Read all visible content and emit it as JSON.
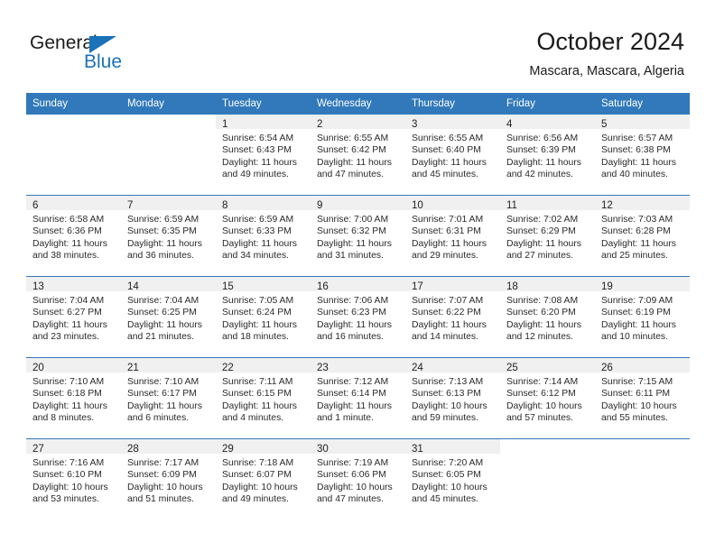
{
  "brand": {
    "name_top": "General",
    "name_bottom": "Blue",
    "triangle_icon": "triangle-icon",
    "accent_color": "#1a72b8"
  },
  "header": {
    "title": "October 2024",
    "subtitle": "Mascara, Mascara, Algeria"
  },
  "theme": {
    "header_blue": "#3179ba",
    "daynum_band": "#f0f0f0",
    "text": "#222222"
  },
  "weekday_headers": [
    "Sunday",
    "Monday",
    "Tuesday",
    "Wednesday",
    "Thursday",
    "Friday",
    "Saturday"
  ],
  "weeks": [
    [
      {
        "day": "",
        "sunrise": "",
        "sunset": "",
        "daylight": "",
        "empty": true
      },
      {
        "day": "",
        "sunrise": "",
        "sunset": "",
        "daylight": "",
        "empty": true
      },
      {
        "day": "1",
        "sunrise": "Sunrise: 6:54 AM",
        "sunset": "Sunset: 6:43 PM",
        "daylight": "Daylight: 11 hours and 49 minutes."
      },
      {
        "day": "2",
        "sunrise": "Sunrise: 6:55 AM",
        "sunset": "Sunset: 6:42 PM",
        "daylight": "Daylight: 11 hours and 47 minutes."
      },
      {
        "day": "3",
        "sunrise": "Sunrise: 6:55 AM",
        "sunset": "Sunset: 6:40 PM",
        "daylight": "Daylight: 11 hours and 45 minutes."
      },
      {
        "day": "4",
        "sunrise": "Sunrise: 6:56 AM",
        "sunset": "Sunset: 6:39 PM",
        "daylight": "Daylight: 11 hours and 42 minutes."
      },
      {
        "day": "5",
        "sunrise": "Sunrise: 6:57 AM",
        "sunset": "Sunset: 6:38 PM",
        "daylight": "Daylight: 11 hours and 40 minutes."
      }
    ],
    [
      {
        "day": "6",
        "sunrise": "Sunrise: 6:58 AM",
        "sunset": "Sunset: 6:36 PM",
        "daylight": "Daylight: 11 hours and 38 minutes."
      },
      {
        "day": "7",
        "sunrise": "Sunrise: 6:59 AM",
        "sunset": "Sunset: 6:35 PM",
        "daylight": "Daylight: 11 hours and 36 minutes."
      },
      {
        "day": "8",
        "sunrise": "Sunrise: 6:59 AM",
        "sunset": "Sunset: 6:33 PM",
        "daylight": "Daylight: 11 hours and 34 minutes."
      },
      {
        "day": "9",
        "sunrise": "Sunrise: 7:00 AM",
        "sunset": "Sunset: 6:32 PM",
        "daylight": "Daylight: 11 hours and 31 minutes."
      },
      {
        "day": "10",
        "sunrise": "Sunrise: 7:01 AM",
        "sunset": "Sunset: 6:31 PM",
        "daylight": "Daylight: 11 hours and 29 minutes."
      },
      {
        "day": "11",
        "sunrise": "Sunrise: 7:02 AM",
        "sunset": "Sunset: 6:29 PM",
        "daylight": "Daylight: 11 hours and 27 minutes."
      },
      {
        "day": "12",
        "sunrise": "Sunrise: 7:03 AM",
        "sunset": "Sunset: 6:28 PM",
        "daylight": "Daylight: 11 hours and 25 minutes."
      }
    ],
    [
      {
        "day": "13",
        "sunrise": "Sunrise: 7:04 AM",
        "sunset": "Sunset: 6:27 PM",
        "daylight": "Daylight: 11 hours and 23 minutes."
      },
      {
        "day": "14",
        "sunrise": "Sunrise: 7:04 AM",
        "sunset": "Sunset: 6:25 PM",
        "daylight": "Daylight: 11 hours and 21 minutes."
      },
      {
        "day": "15",
        "sunrise": "Sunrise: 7:05 AM",
        "sunset": "Sunset: 6:24 PM",
        "daylight": "Daylight: 11 hours and 18 minutes."
      },
      {
        "day": "16",
        "sunrise": "Sunrise: 7:06 AM",
        "sunset": "Sunset: 6:23 PM",
        "daylight": "Daylight: 11 hours and 16 minutes."
      },
      {
        "day": "17",
        "sunrise": "Sunrise: 7:07 AM",
        "sunset": "Sunset: 6:22 PM",
        "daylight": "Daylight: 11 hours and 14 minutes."
      },
      {
        "day": "18",
        "sunrise": "Sunrise: 7:08 AM",
        "sunset": "Sunset: 6:20 PM",
        "daylight": "Daylight: 11 hours and 12 minutes."
      },
      {
        "day": "19",
        "sunrise": "Sunrise: 7:09 AM",
        "sunset": "Sunset: 6:19 PM",
        "daylight": "Daylight: 11 hours and 10 minutes."
      }
    ],
    [
      {
        "day": "20",
        "sunrise": "Sunrise: 7:10 AM",
        "sunset": "Sunset: 6:18 PM",
        "daylight": "Daylight: 11 hours and 8 minutes."
      },
      {
        "day": "21",
        "sunrise": "Sunrise: 7:10 AM",
        "sunset": "Sunset: 6:17 PM",
        "daylight": "Daylight: 11 hours and 6 minutes."
      },
      {
        "day": "22",
        "sunrise": "Sunrise: 7:11 AM",
        "sunset": "Sunset: 6:15 PM",
        "daylight": "Daylight: 11 hours and 4 minutes."
      },
      {
        "day": "23",
        "sunrise": "Sunrise: 7:12 AM",
        "sunset": "Sunset: 6:14 PM",
        "daylight": "Daylight: 11 hours and 1 minute."
      },
      {
        "day": "24",
        "sunrise": "Sunrise: 7:13 AM",
        "sunset": "Sunset: 6:13 PM",
        "daylight": "Daylight: 10 hours and 59 minutes."
      },
      {
        "day": "25",
        "sunrise": "Sunrise: 7:14 AM",
        "sunset": "Sunset: 6:12 PM",
        "daylight": "Daylight: 10 hours and 57 minutes."
      },
      {
        "day": "26",
        "sunrise": "Sunrise: 7:15 AM",
        "sunset": "Sunset: 6:11 PM",
        "daylight": "Daylight: 10 hours and 55 minutes."
      }
    ],
    [
      {
        "day": "27",
        "sunrise": "Sunrise: 7:16 AM",
        "sunset": "Sunset: 6:10 PM",
        "daylight": "Daylight: 10 hours and 53 minutes."
      },
      {
        "day": "28",
        "sunrise": "Sunrise: 7:17 AM",
        "sunset": "Sunset: 6:09 PM",
        "daylight": "Daylight: 10 hours and 51 minutes."
      },
      {
        "day": "29",
        "sunrise": "Sunrise: 7:18 AM",
        "sunset": "Sunset: 6:07 PM",
        "daylight": "Daylight: 10 hours and 49 minutes."
      },
      {
        "day": "30",
        "sunrise": "Sunrise: 7:19 AM",
        "sunset": "Sunset: 6:06 PM",
        "daylight": "Daylight: 10 hours and 47 minutes."
      },
      {
        "day": "31",
        "sunrise": "Sunrise: 7:20 AM",
        "sunset": "Sunset: 6:05 PM",
        "daylight": "Daylight: 10 hours and 45 minutes."
      },
      {
        "day": "",
        "sunrise": "",
        "sunset": "",
        "daylight": "",
        "empty": true
      },
      {
        "day": "",
        "sunrise": "",
        "sunset": "",
        "daylight": "",
        "empty": true
      }
    ]
  ]
}
